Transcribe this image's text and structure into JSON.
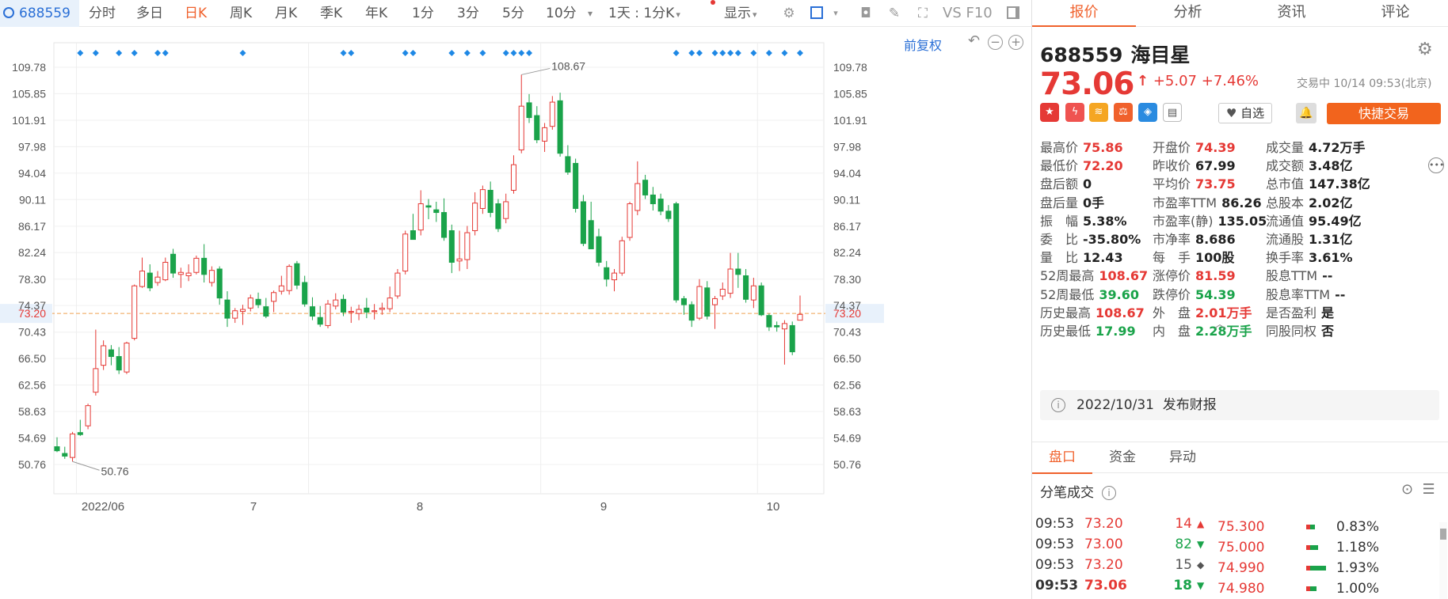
{
  "toolbar": {
    "stock_code": "688559",
    "periods": [
      "分时",
      "多日",
      "日K",
      "周K",
      "月K",
      "季K",
      "年K",
      "1分",
      "3分",
      "5分",
      "10分"
    ],
    "active_period": "日K",
    "interval_select": "1天 : 1分K",
    "display_label": "显示",
    "vs_label": "VS F10",
    "icons": [
      "settings-icon",
      "checkbox-icon",
      "camera-icon",
      "pen-icon",
      "fullscreen-icon",
      "panel-toggle-icon"
    ]
  },
  "chart": {
    "adjust_label": "前复权",
    "price_ticks": [
      "109.78",
      "105.85",
      "101.91",
      "97.98",
      "94.04",
      "90.11",
      "86.17",
      "82.24",
      "78.30",
      "74.37",
      "70.43",
      "66.50",
      "62.56",
      "58.63",
      "54.69",
      "50.76"
    ],
    "current_price_tag": "73.20",
    "max_label": "108.67",
    "min_label": "50.76",
    "x_labels": [
      "2022/06",
      "7",
      "8",
      "9",
      "10"
    ],
    "colors": {
      "up": "#e53935",
      "down": "#1aa34a",
      "marker": "#1e88e5",
      "dashed": "#f0a050"
    }
  },
  "chart_data": {
    "type": "candlestick",
    "ylim": [
      49.0,
      111.0
    ],
    "price_line": 73.2,
    "candles": [
      {
        "o": 53.4,
        "h": 54.8,
        "l": 52.6,
        "c": 52.8
      },
      {
        "o": 52.4,
        "h": 53.4,
        "l": 51.6,
        "c": 52.0
      },
      {
        "o": 51.8,
        "h": 55.6,
        "l": 51.2,
        "c": 55.3
      },
      {
        "o": 55.5,
        "h": 57.4,
        "l": 55.0,
        "c": 55.2
      },
      {
        "o": 56.5,
        "h": 59.8,
        "l": 56.0,
        "c": 59.5
      },
      {
        "o": 61.5,
        "h": 70.8,
        "l": 61.0,
        "c": 65.0
      },
      {
        "o": 65.5,
        "h": 69.2,
        "l": 64.8,
        "c": 68.4
      },
      {
        "o": 67.8,
        "h": 68.5,
        "l": 65.5,
        "c": 66.8
      },
      {
        "o": 66.8,
        "h": 68.2,
        "l": 64.2,
        "c": 64.8
      },
      {
        "o": 64.5,
        "h": 69.0,
        "l": 64.2,
        "c": 68.8
      },
      {
        "o": 69.5,
        "h": 77.5,
        "l": 69.2,
        "c": 77.3
      },
      {
        "o": 77.2,
        "h": 81.5,
        "l": 77.0,
        "c": 79.5
      },
      {
        "o": 79.2,
        "h": 80.5,
        "l": 76.5,
        "c": 77.0
      },
      {
        "o": 77.8,
        "h": 79.5,
        "l": 77.3,
        "c": 78.6
      },
      {
        "o": 78.2,
        "h": 81.5,
        "l": 78.0,
        "c": 80.8
      },
      {
        "o": 82.0,
        "h": 82.8,
        "l": 78.5,
        "c": 79.2
      },
      {
        "o": 79.0,
        "h": 80.0,
        "l": 77.0,
        "c": 79.3
      },
      {
        "o": 78.8,
        "h": 80.5,
        "l": 78.0,
        "c": 79.2
      },
      {
        "o": 79.3,
        "h": 81.8,
        "l": 79.0,
        "c": 81.4
      },
      {
        "o": 81.4,
        "h": 83.5,
        "l": 77.8,
        "c": 79.0
      },
      {
        "o": 77.8,
        "h": 80.2,
        "l": 77.2,
        "c": 79.6
      },
      {
        "o": 79.8,
        "h": 80.2,
        "l": 74.5,
        "c": 75.5
      },
      {
        "o": 75.2,
        "h": 76.5,
        "l": 71.2,
        "c": 72.5
      },
      {
        "o": 72.5,
        "h": 74.0,
        "l": 71.8,
        "c": 73.6
      },
      {
        "o": 73.5,
        "h": 74.5,
        "l": 71.5,
        "c": 73.8
      },
      {
        "o": 74.0,
        "h": 76.0,
        "l": 73.5,
        "c": 75.5
      },
      {
        "o": 75.3,
        "h": 76.3,
        "l": 74.0,
        "c": 74.5
      },
      {
        "o": 74.2,
        "h": 75.5,
        "l": 72.5,
        "c": 72.8
      },
      {
        "o": 75.0,
        "h": 76.6,
        "l": 73.4,
        "c": 76.3
      },
      {
        "o": 76.5,
        "h": 78.8,
        "l": 76.0,
        "c": 77.3
      },
      {
        "o": 76.6,
        "h": 80.5,
        "l": 76.0,
        "c": 80.2
      },
      {
        "o": 80.6,
        "h": 81.0,
        "l": 76.8,
        "c": 77.4
      },
      {
        "o": 77.8,
        "h": 78.8,
        "l": 74.2,
        "c": 74.6
      },
      {
        "o": 74.2,
        "h": 75.6,
        "l": 72.2,
        "c": 72.8
      },
      {
        "o": 72.6,
        "h": 74.3,
        "l": 71.2,
        "c": 71.6
      },
      {
        "o": 71.4,
        "h": 75.2,
        "l": 71.0,
        "c": 74.6
      },
      {
        "o": 74.3,
        "h": 76.2,
        "l": 73.8,
        "c": 75.2
      },
      {
        "o": 75.3,
        "h": 76.0,
        "l": 72.8,
        "c": 73.4
      },
      {
        "o": 73.4,
        "h": 74.2,
        "l": 71.8,
        "c": 73.5
      },
      {
        "o": 73.2,
        "h": 74.5,
        "l": 72.2,
        "c": 73.8
      },
      {
        "o": 74.0,
        "h": 75.5,
        "l": 72.5,
        "c": 73.4
      },
      {
        "o": 73.5,
        "h": 74.6,
        "l": 72.3,
        "c": 73.6
      },
      {
        "o": 73.8,
        "h": 74.8,
        "l": 73.0,
        "c": 74.0
      },
      {
        "o": 73.9,
        "h": 77.2,
        "l": 73.4,
        "c": 75.5
      },
      {
        "o": 75.8,
        "h": 79.8,
        "l": 75.4,
        "c": 79.2
      },
      {
        "o": 79.5,
        "h": 85.5,
        "l": 79.0,
        "c": 85.0
      },
      {
        "o": 85.5,
        "h": 88.0,
        "l": 84.5,
        "c": 84.2
      },
      {
        "o": 85.6,
        "h": 91.5,
        "l": 84.8,
        "c": 89.5
      },
      {
        "o": 89.2,
        "h": 90.2,
        "l": 87.2,
        "c": 89.0
      },
      {
        "o": 88.6,
        "h": 89.8,
        "l": 86.8,
        "c": 88.2
      },
      {
        "o": 88.2,
        "h": 90.3,
        "l": 84.0,
        "c": 84.5
      },
      {
        "o": 85.5,
        "h": 86.4,
        "l": 79.2,
        "c": 80.8
      },
      {
        "o": 81.0,
        "h": 85.5,
        "l": 79.5,
        "c": 81.3
      },
      {
        "o": 81.2,
        "h": 86.2,
        "l": 79.8,
        "c": 85.2
      },
      {
        "o": 85.5,
        "h": 91.2,
        "l": 84.8,
        "c": 89.6
      },
      {
        "o": 88.8,
        "h": 92.2,
        "l": 88.0,
        "c": 91.6
      },
      {
        "o": 91.5,
        "h": 92.8,
        "l": 87.5,
        "c": 88.2
      },
      {
        "o": 89.5,
        "h": 90.2,
        "l": 85.3,
        "c": 85.8
      },
      {
        "o": 87.3,
        "h": 91.0,
        "l": 86.6,
        "c": 89.8
      },
      {
        "o": 91.5,
        "h": 96.7,
        "l": 91.0,
        "c": 95.3
      },
      {
        "o": 97.5,
        "h": 108.67,
        "l": 97.0,
        "c": 104.0
      },
      {
        "o": 104.5,
        "h": 105.8,
        "l": 101.5,
        "c": 102.3
      },
      {
        "o": 102.6,
        "h": 104.0,
        "l": 98.5,
        "c": 99.0
      },
      {
        "o": 98.8,
        "h": 101.5,
        "l": 97.2,
        "c": 100.8
      },
      {
        "o": 101.0,
        "h": 105.5,
        "l": 100.5,
        "c": 104.6
      },
      {
        "o": 104.8,
        "h": 106.0,
        "l": 96.5,
        "c": 97.0
      },
      {
        "o": 96.5,
        "h": 98.2,
        "l": 93.8,
        "c": 94.2
      },
      {
        "o": 95.5,
        "h": 96.2,
        "l": 88.2,
        "c": 88.8
      },
      {
        "o": 89.8,
        "h": 90.8,
        "l": 83.2,
        "c": 83.6
      },
      {
        "o": 87.0,
        "h": 89.8,
        "l": 86.3,
        "c": 82.8
      },
      {
        "o": 84.6,
        "h": 85.8,
        "l": 80.2,
        "c": 80.8
      },
      {
        "o": 80.0,
        "h": 81.0,
        "l": 77.2,
        "c": 78.3
      },
      {
        "o": 78.2,
        "h": 79.8,
        "l": 76.5,
        "c": 79.2
      },
      {
        "o": 79.2,
        "h": 84.6,
        "l": 78.8,
        "c": 84.0
      },
      {
        "o": 84.5,
        "h": 89.8,
        "l": 84.0,
        "c": 89.5
      },
      {
        "o": 88.5,
        "h": 95.8,
        "l": 87.8,
        "c": 92.5
      },
      {
        "o": 93.0,
        "h": 93.8,
        "l": 90.2,
        "c": 90.8
      },
      {
        "o": 90.8,
        "h": 92.0,
        "l": 88.5,
        "c": 89.5
      },
      {
        "o": 90.2,
        "h": 91.0,
        "l": 87.8,
        "c": 88.4
      },
      {
        "o": 88.4,
        "h": 89.3,
        "l": 86.8,
        "c": 87.3
      },
      {
        "o": 89.5,
        "h": 89.8,
        "l": 74.8,
        "c": 75.2
      },
      {
        "o": 75.4,
        "h": 75.8,
        "l": 73.0,
        "c": 74.5
      },
      {
        "o": 74.5,
        "h": 75.0,
        "l": 71.2,
        "c": 72.2
      },
      {
        "o": 72.5,
        "h": 78.3,
        "l": 72.2,
        "c": 77.2
      },
      {
        "o": 77.0,
        "h": 78.0,
        "l": 72.3,
        "c": 72.8
      },
      {
        "o": 74.5,
        "h": 75.8,
        "l": 70.9,
        "c": 75.4
      },
      {
        "o": 75.8,
        "h": 77.8,
        "l": 75.2,
        "c": 76.8
      },
      {
        "o": 76.2,
        "h": 82.2,
        "l": 75.5,
        "c": 79.8
      },
      {
        "o": 79.8,
        "h": 82.2,
        "l": 77.0,
        "c": 79.0
      },
      {
        "o": 78.8,
        "h": 79.8,
        "l": 74.8,
        "c": 75.3
      },
      {
        "o": 75.2,
        "h": 78.5,
        "l": 74.0,
        "c": 77.3
      },
      {
        "o": 77.3,
        "h": 77.8,
        "l": 72.8,
        "c": 73.0
      },
      {
        "o": 72.9,
        "h": 73.2,
        "l": 70.6,
        "c": 71.2
      },
      {
        "o": 71.4,
        "h": 72.0,
        "l": 70.5,
        "c": 71.2
      },
      {
        "o": 70.9,
        "h": 72.2,
        "l": 65.6,
        "c": 71.7
      },
      {
        "o": 71.4,
        "h": 72.0,
        "l": 67.0,
        "c": 67.5
      },
      {
        "o": 72.2,
        "h": 75.86,
        "l": 72.2,
        "c": 73.06
      }
    ],
    "markers": [
      3,
      5,
      8,
      10,
      13,
      14,
      24,
      37,
      38,
      45,
      46,
      51,
      53,
      55,
      58,
      59,
      60,
      61,
      80,
      82,
      83,
      85,
      86,
      87,
      88,
      90,
      92,
      94,
      96
    ]
  },
  "quote": {
    "tabs": [
      "报价",
      "分析",
      "资讯",
      "评论"
    ],
    "active_tab": "报价",
    "code": "688559",
    "name": "海目星",
    "price": "73.06",
    "arrow": "↑",
    "change": "+5.07",
    "change_pct": "+7.46%",
    "status_time": "交易中 10/14 09:53(北京)",
    "watch_label": "自选",
    "fast_trade_label": "快捷交易",
    "stats_col1": [
      {
        "label": "最高价",
        "value": "75.86",
        "color": "red"
      },
      {
        "label": "最低价",
        "value": "72.20",
        "color": "red"
      },
      {
        "label": "盘后额",
        "value": "0",
        "color": ""
      },
      {
        "label": "盘后量",
        "value": "0手",
        "color": ""
      },
      {
        "label": "振　幅",
        "value": "5.38%",
        "color": ""
      },
      {
        "label": "委　比",
        "value": "-35.80%",
        "color": ""
      },
      {
        "label": "量　比",
        "value": "12.43",
        "color": ""
      },
      {
        "label": "52周最高",
        "value": "108.67",
        "color": "red"
      },
      {
        "label": "52周最低",
        "value": "39.60",
        "color": "green"
      },
      {
        "label": "历史最高",
        "value": "108.67",
        "color": "red"
      },
      {
        "label": "历史最低",
        "value": "17.99",
        "color": "green"
      }
    ],
    "stats_col2": [
      {
        "label": "开盘价",
        "value": "74.39",
        "color": "red"
      },
      {
        "label": "昨收价",
        "value": "67.99",
        "color": ""
      },
      {
        "label": "平均价",
        "value": "73.75",
        "color": "red"
      },
      {
        "label": "市盈率TTM",
        "value": "86.26",
        "color": ""
      },
      {
        "label": "市盈率(静)",
        "value": "135.05",
        "color": ""
      },
      {
        "label": "市净率",
        "value": "8.686",
        "color": ""
      },
      {
        "label": "每　手",
        "value": "100股",
        "color": ""
      },
      {
        "label": "涨停价",
        "value": "81.59",
        "color": "red"
      },
      {
        "label": "跌停价",
        "value": "54.39",
        "color": "green"
      },
      {
        "label": "外　盘",
        "value": "2.01万手",
        "color": "red"
      },
      {
        "label": "内　盘",
        "value": "2.28万手",
        "color": "green"
      }
    ],
    "stats_col3": [
      {
        "label": "成交量",
        "value": "4.72万手",
        "color": ""
      },
      {
        "label": "成交额",
        "value": "3.48亿",
        "color": ""
      },
      {
        "label": "总市值",
        "value": "147.38亿",
        "color": ""
      },
      {
        "label": "总股本",
        "value": "2.02亿",
        "color": ""
      },
      {
        "label": "流通值",
        "value": "95.49亿",
        "color": ""
      },
      {
        "label": "流通股",
        "value": "1.31亿",
        "color": ""
      },
      {
        "label": "换手率",
        "value": "3.61%",
        "color": ""
      },
      {
        "label": "股息TTM",
        "value": "--",
        "color": ""
      },
      {
        "label": "股息率TTM",
        "value": "--",
        "color": ""
      },
      {
        "label": "是否盈利",
        "value": "是",
        "color": ""
      },
      {
        "label": "同股同权",
        "value": "否",
        "color": ""
      }
    ],
    "report_date": "2022/10/31",
    "report_label": "发布财报"
  },
  "lower": {
    "tabs": [
      "盘口",
      "资金",
      "异动"
    ],
    "active_tab": "盘口",
    "trades_title": "分笔成交",
    "trades": [
      {
        "time": "09:53",
        "price": "73.20",
        "vol": "14",
        "dir": "up"
      },
      {
        "time": "09:53",
        "price": "73.00",
        "vol": "82",
        "dir": "down"
      },
      {
        "time": "09:53",
        "price": "73.20",
        "vol": "15",
        "dir": "neutral"
      },
      {
        "time": "09:53",
        "price": "73.06",
        "vol": "18",
        "dir": "down"
      }
    ],
    "levels": [
      {
        "price": "75.300",
        "pct": "0.83%",
        "share": 0.0083
      },
      {
        "price": "75.000",
        "pct": "1.18%",
        "share": 0.0118
      },
      {
        "price": "74.990",
        "pct": "1.93%",
        "share": 0.0193
      },
      {
        "price": "74.980",
        "pct": "1.00%",
        "share": 0.01
      }
    ]
  }
}
